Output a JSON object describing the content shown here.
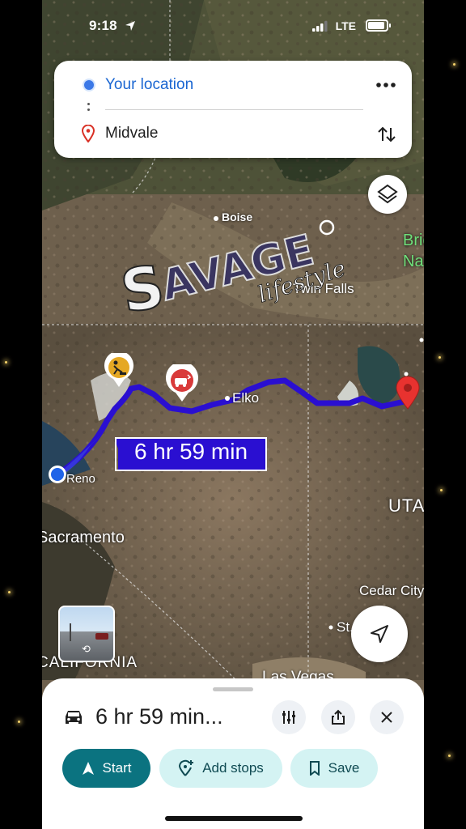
{
  "status_bar": {
    "time": "9:18",
    "network": "LTE"
  },
  "directions": {
    "origin": "Your location",
    "destination": "Midvale"
  },
  "map": {
    "route_duration_label": "6 hr 59 min",
    "route_color": "#3012c9",
    "place_labels": [
      {
        "text": "Boise",
        "name": "label-boise"
      },
      {
        "text": "Elko",
        "name": "label-elko"
      },
      {
        "text": "Twin Falls",
        "name": "label-twin-falls"
      },
      {
        "text": "Reno",
        "name": "label-reno"
      },
      {
        "text": "Sacramento",
        "name": "label-sacramento"
      },
      {
        "text": "UTAH",
        "name": "label-utah"
      },
      {
        "text": "Cedar City",
        "name": "label-cedar-city"
      },
      {
        "text": "St. George",
        "name": "label-st-george"
      },
      {
        "text": "CALIFORNIA",
        "name": "label-california"
      },
      {
        "text": "Las Vegas",
        "name": "label-las-vegas"
      },
      {
        "text": "Bridger National",
        "name": "label-bridger"
      }
    ],
    "watermark": "SAVAGE lifestyle"
  },
  "bottom_sheet": {
    "duration": "6 hr 59 min...",
    "start_label": "Start",
    "add_stops_label": "Add stops",
    "save_label": "Save"
  },
  "icons": [
    "navigation-arrow-icon",
    "signal-icon",
    "battery-icon",
    "more-icon",
    "pin-icon",
    "swap-icon",
    "layers-icon",
    "construction-icon",
    "crash-icon",
    "destination-pin-icon",
    "locate-icon",
    "street-view-icon",
    "car-icon",
    "tune-icon",
    "share-icon",
    "close-icon",
    "start-arrow-icon",
    "add-stop-icon",
    "bookmark-icon"
  ],
  "colors": {
    "accent": "#0b7380",
    "pill_bg": "#d4f3f3",
    "link_blue": "#1a66d2"
  }
}
